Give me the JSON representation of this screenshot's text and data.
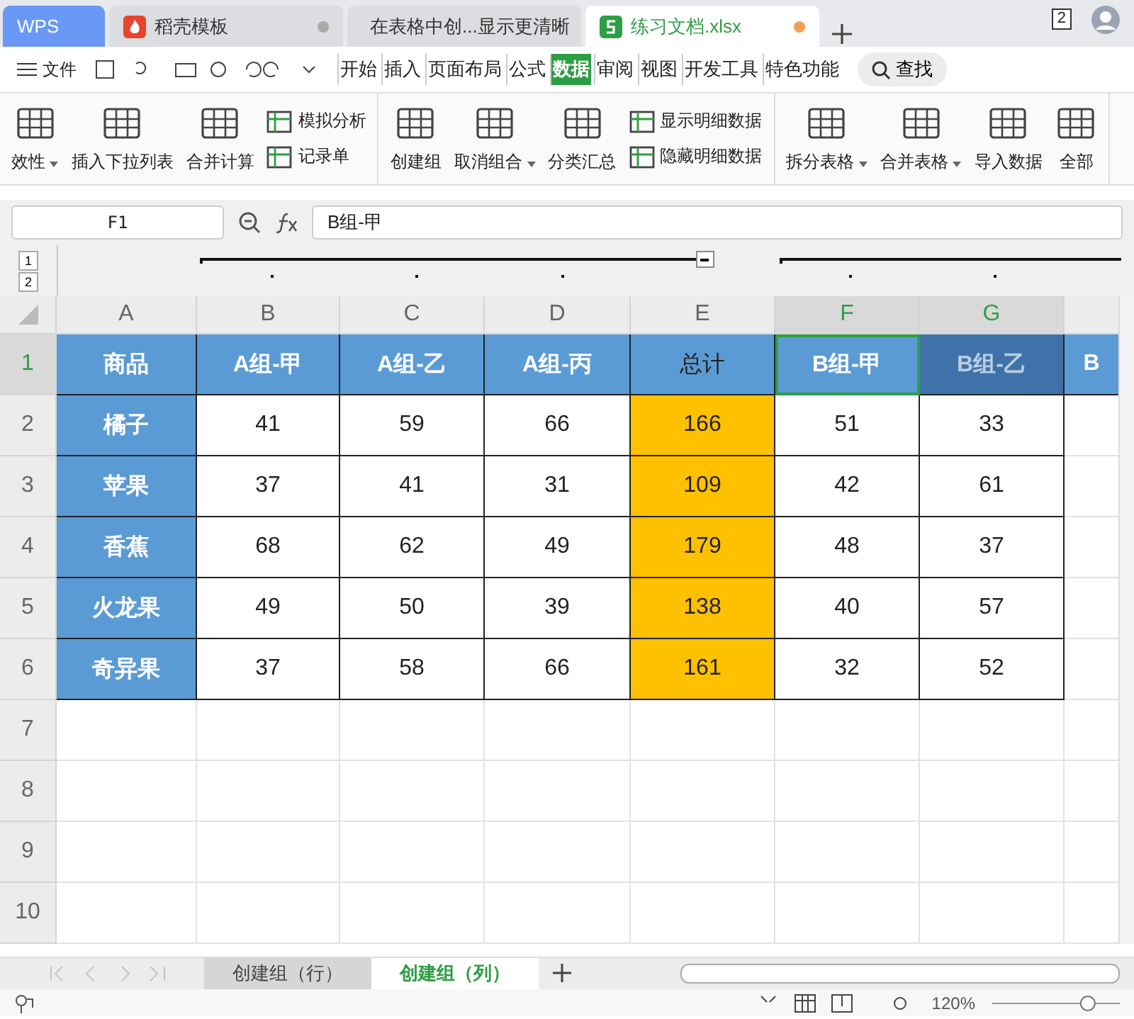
{
  "tabs": [
    {
      "label": "WPS",
      "kind": "wps",
      "selected": false
    },
    {
      "label": "稻壳模板",
      "kind": "template",
      "selected": false
    },
    {
      "label": "在表格中创...显示更清晰",
      "kind": "doc",
      "selected": false
    },
    {
      "label": "练习文档.xlsx",
      "kind": "sheet",
      "selected": true
    }
  ],
  "account": {
    "badge": "2"
  },
  "menu": {
    "file": "文件",
    "items": [
      {
        "label": "开始",
        "selected": false
      },
      {
        "label": "插入",
        "selected": false
      },
      {
        "label": "页面布局",
        "selected": false
      },
      {
        "label": "公式",
        "selected": false
      },
      {
        "label": "数据",
        "selected": true
      },
      {
        "label": "审阅",
        "selected": false
      },
      {
        "label": "视图",
        "selected": false
      },
      {
        "label": "开发工具",
        "selected": false
      },
      {
        "label": "特色功能",
        "selected": false
      }
    ],
    "search": "查找"
  },
  "ribbon": {
    "groups": [
      {
        "items": [
          {
            "label": "效性",
            "kind": "large",
            "dropdown": true
          },
          {
            "label": "插入下拉列表",
            "kind": "large",
            "dropdown": false
          },
          {
            "label": "合并计算",
            "kind": "large",
            "dropdown": false
          },
          {
            "kind": "pair",
            "labels": [
              "模拟分析",
              "记录单"
            ]
          }
        ]
      },
      {
        "items": [
          {
            "label": "创建组",
            "kind": "large",
            "dropdown": false
          },
          {
            "label": "取消组合",
            "kind": "large",
            "dropdown": true
          },
          {
            "label": "分类汇总",
            "kind": "large",
            "dropdown": false
          },
          {
            "kind": "pair",
            "labels": [
              "显示明细数据",
              "隐藏明细数据"
            ]
          }
        ]
      },
      {
        "items": [
          {
            "label": "拆分表格",
            "kind": "large",
            "dropdown": true
          },
          {
            "label": "合并表格",
            "kind": "large",
            "dropdown": true
          },
          {
            "label": "导入数据",
            "kind": "large",
            "dropdown": false
          },
          {
            "label": "全部",
            "kind": "large",
            "dropdown": false
          }
        ]
      }
    ]
  },
  "formula_bar": {
    "name_box": "F1",
    "formula": "B组-甲"
  },
  "outline_levels": [
    "1",
    "2"
  ],
  "table": {
    "columns": [
      {
        "letter": "A",
        "kind": "label",
        "selected": false
      },
      {
        "letter": "B",
        "kind": "data",
        "selected": false
      },
      {
        "letter": "C",
        "kind": "data",
        "selected": false
      },
      {
        "letter": "D",
        "kind": "data",
        "selected": false
      },
      {
        "letter": "E",
        "kind": "total",
        "selected": false
      },
      {
        "letter": "F",
        "kind": "data",
        "selected": true
      },
      {
        "letter": "G",
        "kind": "data",
        "selected": true
      },
      {
        "kind": "data",
        "selected": false
      }
    ],
    "rows": [
      {
        "number": "1",
        "selected": true,
        "cells": [
          "商品",
          "A组-甲",
          "A组-乙",
          "A组-丙",
          "总计",
          "B组-甲",
          "B组-乙",
          "B"
        ]
      },
      {
        "number": "2",
        "selected": false,
        "cells": [
          "橘子",
          "41",
          "59",
          "66",
          "166",
          "51",
          "33"
        ]
      },
      {
        "number": "3",
        "selected": false,
        "cells": [
          "苹果",
          "37",
          "41",
          "31",
          "109",
          "42",
          "61"
        ]
      },
      {
        "number": "4",
        "selected": false,
        "cells": [
          "香蕉",
          "68",
          "62",
          "49",
          "179",
          "48",
          "37"
        ]
      },
      {
        "number": "5",
        "selected": false,
        "cells": [
          "火龙果",
          "49",
          "50",
          "39",
          "138",
          "40",
          "57"
        ]
      },
      {
        "number": "6",
        "selected": false,
        "cells": [
          "奇异果",
          "37",
          "58",
          "66",
          "161",
          "32",
          "52"
        ]
      },
      {
        "number": "7",
        "selected": false,
        "cells": []
      },
      {
        "number": "8",
        "selected": false,
        "cells": []
      },
      {
        "number": "9",
        "selected": false,
        "cells": []
      },
      {
        "number": "10",
        "selected": false,
        "cells": []
      }
    ]
  },
  "sheets": [
    {
      "label": "创建组（行）",
      "selected": false
    },
    {
      "label": "创建组（列）",
      "selected": true
    }
  ],
  "status_bar": {
    "zoom": "120%",
    "zoom_slider": {
      "level": 0.78
    }
  }
}
